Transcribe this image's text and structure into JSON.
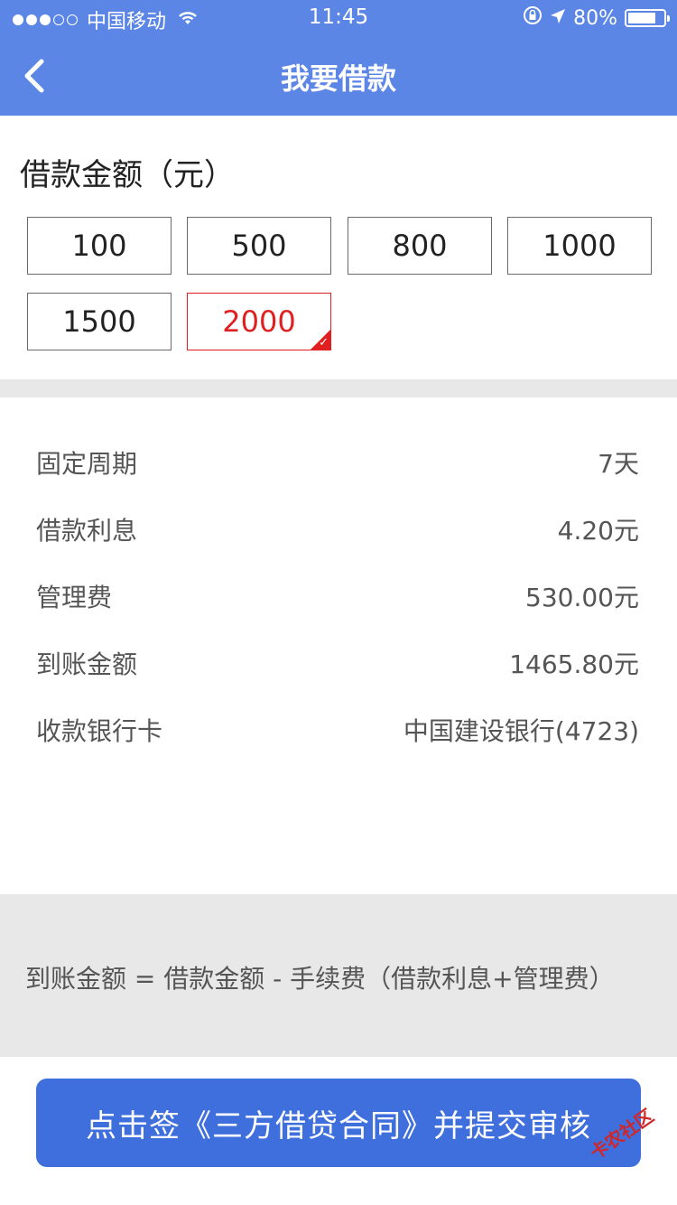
{
  "status_bar": {
    "carrier": "中国移动",
    "time": "11:45",
    "battery_percent": "80%",
    "battery_level": 0.8
  },
  "nav": {
    "title": "我要借款",
    "back_icon": "chevron-left-icon"
  },
  "amount": {
    "title": "借款金额（元）",
    "options": [
      "100",
      "500",
      "800",
      "1000",
      "1500",
      "2000"
    ],
    "selected": "2000"
  },
  "details": [
    {
      "label": "固定周期",
      "value": "7天"
    },
    {
      "label": "借款利息",
      "value": "4.20元"
    },
    {
      "label": "管理费",
      "value": "530.00元"
    },
    {
      "label": "到账金额",
      "value": "1465.80元"
    },
    {
      "label": "收款银行卡",
      "value": "中国建设银行(4723)"
    }
  ],
  "formula": "到账金额 = 借款金额 - 手续费（借款利息+管理费）",
  "submit_label": "点击签《三方借贷合同》并提交审核",
  "watermark": "卡农社区",
  "colors": {
    "header": "#5b86e5",
    "button": "#3f6fdc",
    "selected": "#e02020",
    "gray_band": "#e8e8e8"
  }
}
